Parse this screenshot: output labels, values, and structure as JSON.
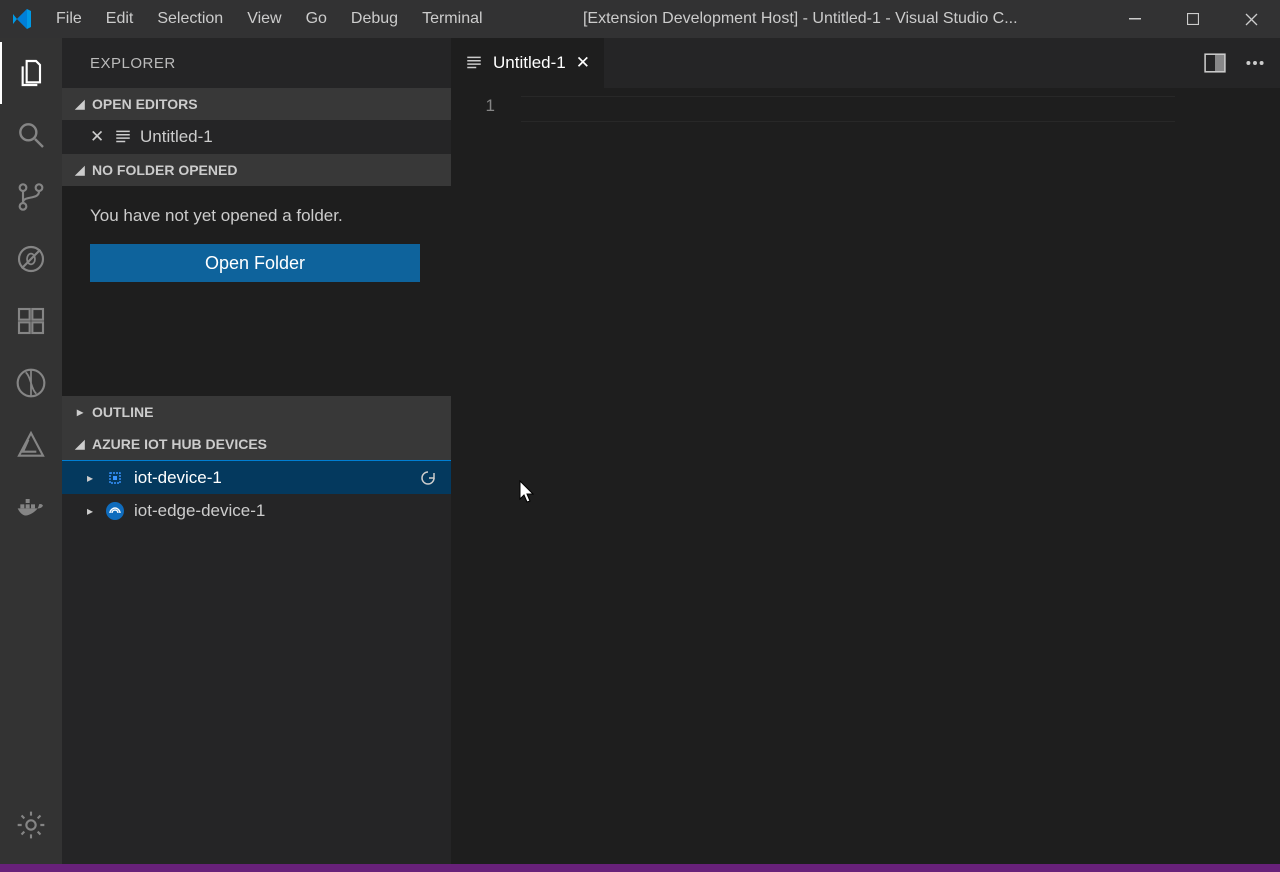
{
  "titlebar": {
    "title": "[Extension Development Host] - Untitled-1 - Visual Studio C...",
    "menus": [
      "File",
      "Edit",
      "Selection",
      "View",
      "Go",
      "Debug",
      "Terminal"
    ]
  },
  "sidebar": {
    "title": "EXPLORER",
    "open_editors": {
      "label": "OPEN EDITORS",
      "items": [
        {
          "name": "Untitled-1"
        }
      ]
    },
    "no_folder": {
      "label": "NO FOLDER OPENED",
      "message": "You have not yet opened a folder.",
      "button": "Open Folder"
    },
    "outline": {
      "label": "OUTLINE"
    },
    "iot": {
      "label": "AZURE IOT HUB DEVICES",
      "devices": [
        {
          "name": "iot-device-1",
          "selected": true
        },
        {
          "name": "iot-edge-device-1",
          "selected": false
        }
      ]
    }
  },
  "editor": {
    "tab": "Untitled-1",
    "line_number": "1"
  }
}
